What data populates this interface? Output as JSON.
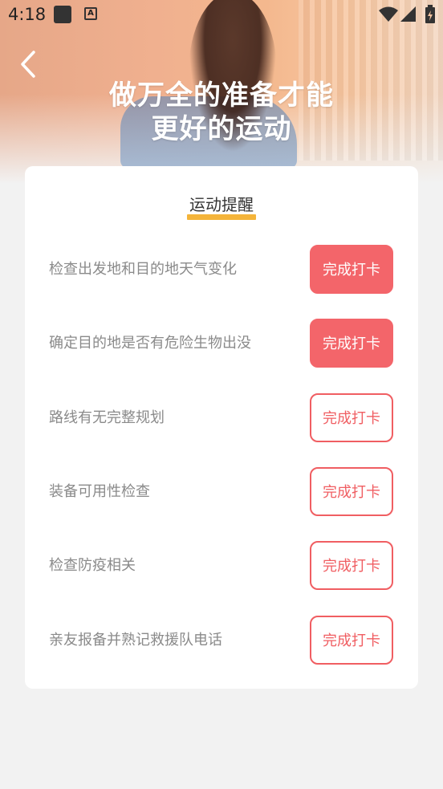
{
  "status_bar": {
    "time": "4:18",
    "icons": [
      "app-square-icon",
      "a-notification-icon",
      "wifi-icon",
      "signal-icon",
      "battery-icon"
    ]
  },
  "header": {
    "back_icon": "chevron-left-icon",
    "title_line1": "做万全的准备才能",
    "title_line2": "更好的运动"
  },
  "card": {
    "title": "运动提醒",
    "accent_color": "#f4b43a",
    "items": [
      {
        "label": "检查出发地和目的地天气变化",
        "button": "完成打卡",
        "checked": true
      },
      {
        "label": "确定目的地是否有危险生物出没",
        "button": "完成打卡",
        "checked": true
      },
      {
        "label": "路线有无完整规划",
        "button": "完成打卡",
        "checked": false
      },
      {
        "label": "装备可用性检查",
        "button": "完成打卡",
        "checked": false
      },
      {
        "label": "检查防疫相关",
        "button": "完成打卡",
        "checked": false
      },
      {
        "label": "亲友报备并熟记救援队电话",
        "button": "完成打卡",
        "checked": false
      }
    ]
  },
  "colors": {
    "button_red": "#f3656a",
    "background": "#f2f2f2"
  }
}
